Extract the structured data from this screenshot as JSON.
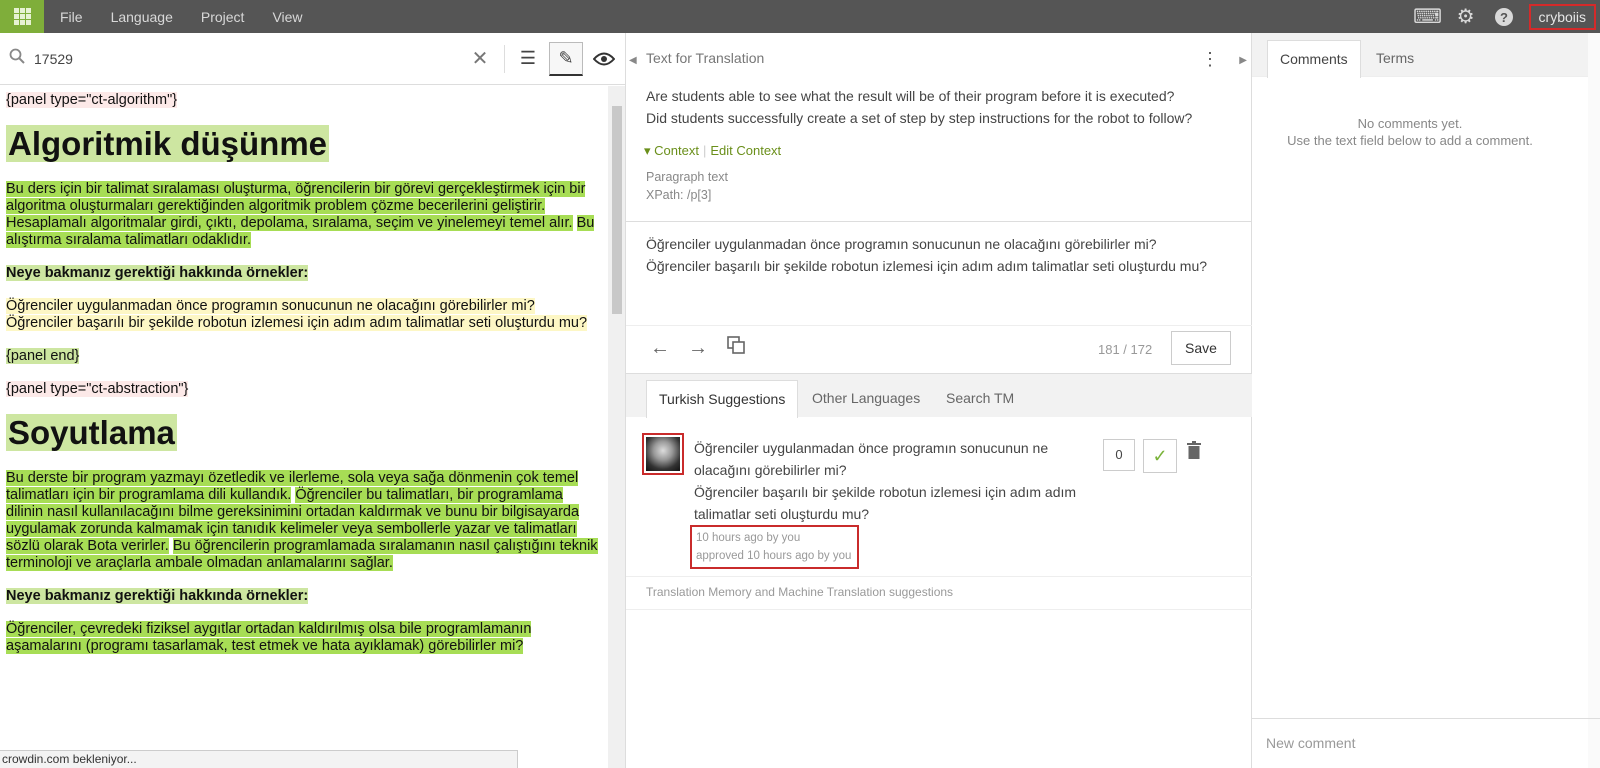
{
  "topbar": {
    "menu": [
      "File",
      "Language",
      "Project",
      "View"
    ],
    "user": "cryboiis"
  },
  "search": {
    "value": "17529"
  },
  "doc": {
    "tag1": "{panel type=\"ct-algorithm\"}",
    "heading1": "Algoritmik düşünme",
    "para1_a": "Bu ders için bir talimat sıralaması oluşturma, öğrencilerin bir görevi gerçekleştirmek için bir algoritma oluşturmaları gerektiğinden algoritmik problem çözme becerilerini geliştirir.",
    "para1_b": "Hesaplamalı algoritmalar girdi, çıktı, depolama, sıralama, seçim ve yinelemeyi temel alır.",
    "para1_c": "Bu alıştırma sıralama talimatları odaklıdır.",
    "examples1": "Neye bakmanız gerektiği hakkında örnekler:",
    "q1": "Öğrenciler uygulanmadan önce programın sonucunun ne olacağını görebilirler mi? Öğrenciler başarılı bir şekilde robotun izlemesi için adım adım talimatlar seti oluşturdu mu?",
    "tag_end": "{panel end}",
    "tag2": "{panel type=\"ct-abstraction\"}",
    "heading2": "Soyutlama",
    "para2_a": "Bu derste bir program yazmayı özetledik ve ilerleme, sola veya sağa dönmenin çok temel talimatları için bir programlama dili kullandık.",
    "para2_b": "Öğrenciler bu talimatları, bir programlama dilinin nasıl kullanılacağını bilme gereksinimini ortadan kaldırmak ve bunu bir bilgisayarda uygulamak zorunda kalmamak için tanıdık kelimeler veya sembollerle yazar ve talimatları sözlü olarak Bota verirler.",
    "para2_c": "Bu öğrencilerin programlamada sıralamanın nasıl çalıştığını teknik terminoloji ve araçlarla ambale olmadan anlamalarını sağlar.",
    "examples2": "Neye bakmanız gerektiği hakkında örnekler:",
    "q2": "Öğrenciler, çevredeki fiziksel aygıtlar ortadan kaldırılmış olsa bile programlamanın aşamalarını (programı tasarlamak, test etmek ve hata ayıklamak) görebilirler mi?"
  },
  "status": "crowdin.com bekleniyor...",
  "editor": {
    "title": "Text for Translation",
    "source_line1": "Are students able to see what the result will be of their program before it is executed?",
    "source_line2": "Did students successfully create a set of step by step instructions for the robot to follow?",
    "context": "Context",
    "edit_context": "Edit Context",
    "meta1": "Paragraph text",
    "meta2": "XPath: /p[3]",
    "trans_line1": "Öğrenciler uygulanmadan önce programın sonucunun ne olacağını görebilirler mi?",
    "trans_line2": "Öğrenciler başarılı bir şekilde robotun izlemesi için adım adım talimatlar seti oluşturdu mu?",
    "counter": "181 / 172",
    "save": "Save"
  },
  "tabs": [
    "Turkish Suggestions",
    "Other Languages",
    "Search TM"
  ],
  "suggestion": {
    "text1": "Öğrenciler uygulanmadan önce programın sonucunun ne olacağını görebilirler mi?",
    "text2": "Öğrenciler başarılı bir şekilde robotun izlemesi için adım adım talimatlar seti oluşturdu mu?",
    "meta1": "10 hours ago by you",
    "meta2": "approved 10 hours ago by you",
    "votes": "0"
  },
  "tm_note": "Translation Memory and Machine Translation suggestions",
  "comments": {
    "tabs": [
      "Comments",
      "Terms"
    ],
    "empty1": "No comments yet.",
    "empty2": "Use the text field below to add a comment.",
    "placeholder": "New comment"
  },
  "icons": {
    "search": "search-icon",
    "clear": "close-icon",
    "list": "list-icon",
    "edit": "pencil-icon",
    "preview": "eye-icon",
    "keyboard": "keyboard-icon",
    "settings": "gear-icon",
    "help": "help-icon"
  }
}
